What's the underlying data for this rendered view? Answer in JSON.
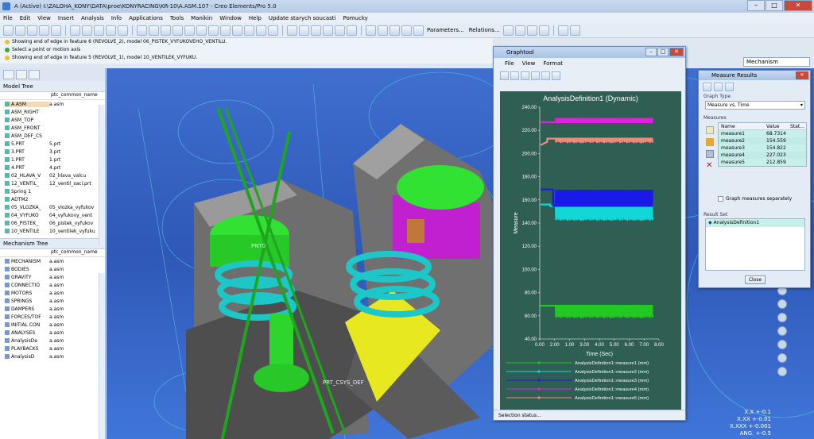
{
  "window": {
    "title": "A (Active) I:\\ZALOHA_KONY\\DATA\\proe\\KONYRACING\\KR-10\\A.ASM.107 - Creo Elements/Pro 5.0"
  },
  "menu": [
    "File",
    "Edit",
    "View",
    "Insert",
    "Analysis",
    "Info",
    "Applications",
    "Tools",
    "Manikin",
    "Window",
    "Help",
    "Update starych soucasti",
    "Pomucky"
  ],
  "toolbar": {
    "parameters": "Parameters...",
    "relations": "Relations..."
  },
  "messages": [
    "Showing end of edge in feature 6 (REVOLVE_2), model 06_PISTEK_VYFUKOVEHO_VENTILU.",
    "Select a point or motion axis",
    "Showing end of edge in feature 5 (REVOLVE_1), model 10_VENTILEK_VYFUKU."
  ],
  "model_tree": {
    "title": "Model Tree",
    "col": "ptc_common_name",
    "rows": [
      {
        "name": "A.ASM",
        "val": "a.asm",
        "sel": true
      },
      {
        "name": "ASM_RIGHT",
        "val": ""
      },
      {
        "name": "ASM_TOP",
        "val": ""
      },
      {
        "name": "ASM_FRONT",
        "val": ""
      },
      {
        "name": "ASM_DEF_CS",
        "val": ""
      },
      {
        "name": "5.PRT",
        "val": "5.prt"
      },
      {
        "name": "3.PRT",
        "val": "3.prt"
      },
      {
        "name": "1.PRT",
        "val": "1.prt"
      },
      {
        "name": "4.PRT",
        "val": "4.prt"
      },
      {
        "name": "02_HLAVA_V",
        "val": "02_hlava_valcu"
      },
      {
        "name": "12_VENTIL_",
        "val": "12_ventil_saci.prt"
      },
      {
        "name": "Spring 1",
        "val": ""
      },
      {
        "name": "ADTM2",
        "val": ""
      },
      {
        "name": "05_VLOZKA_",
        "val": "05_vlozka_vyfukov"
      },
      {
        "name": "04_VYFUKO",
        "val": "04_vyfukovy_vent"
      },
      {
        "name": "06_PISTEK_",
        "val": "06_pistek_vyfukov"
      },
      {
        "name": "10_VENTILE",
        "val": "10_ventilek_vyfuku"
      }
    ]
  },
  "mech_tree": {
    "title": "Mechanism Tree",
    "col": "ptc_common_name",
    "rows": [
      {
        "name": "MECHANISM",
        "val": "a.asm"
      },
      {
        "name": "BODIES",
        "val": "a.asm"
      },
      {
        "name": "GRAVITY",
        "val": "a.asm"
      },
      {
        "name": "CONNECTIO",
        "val": "a.asm"
      },
      {
        "name": "MOTORS",
        "val": "a.asm"
      },
      {
        "name": "SPRINGS",
        "val": "a.asm"
      },
      {
        "name": "DAMPERS",
        "val": "a.asm"
      },
      {
        "name": "FORCES/TOF",
        "val": "a.asm"
      },
      {
        "name": "INITIAL CON",
        "val": "a.asm"
      },
      {
        "name": "ANALYSES",
        "val": "a.asm"
      },
      {
        "name": "AnalysisDe",
        "val": "a.asm"
      },
      {
        "name": "PLAYBACKS",
        "val": "a.asm"
      },
      {
        "name": "AnalysisD",
        "val": "a.asm"
      }
    ]
  },
  "viewport": {
    "labels": [
      "PNT0",
      "PRT_CSYS_DEF"
    ]
  },
  "mechanism_dropdown": "Mechanism",
  "tolerances": [
    "X.X +-0.1",
    "X.XX +-0.01",
    "X.XXX +-0.001",
    "ANG. +-0.5"
  ],
  "graphtool": {
    "title": "Graphtool",
    "menu": [
      "File",
      "View",
      "Format"
    ],
    "status": "Selection status..."
  },
  "chart_data": {
    "type": "line",
    "title": "AnalysisDefinition1 (Dynamic)",
    "xlabel": "Time (Sec)",
    "ylabel": "Measure",
    "xlim": [
      0,
      8
    ],
    "ylim": [
      40,
      240
    ],
    "xticks": [
      "0.00",
      "2.00",
      "1.00",
      "3.00",
      "4.00",
      "5.00",
      "6.00",
      "7.00",
      "8.00"
    ],
    "yticks": [
      "40.00",
      "60.00",
      "80.00",
      "100.00",
      "120.00",
      "140.00",
      "160.00",
      "180.00",
      "200.00",
      "220.00",
      "240.00"
    ],
    "series": [
      {
        "name": "AnalysisDefinition1::measure1 (mm)",
        "color": "#22c922",
        "base": 68.7,
        "dip": 58
      },
      {
        "name": "AnalysisDefinition1::measure2 (mm)",
        "color": "#13d6d6",
        "base": 154.6,
        "dip": 142
      },
      {
        "name": "AnalysisDefinition1::measure3 (mm)",
        "color": "#1a1ae8",
        "base": 154.8,
        "peak": 168
      },
      {
        "name": "AnalysisDefinition1::measure4 (mm)",
        "color": "#e020e0",
        "base": 227.0,
        "peak": 230
      },
      {
        "name": "AnalysisDefinition1::measure5 (mm)",
        "color": "#f08a7a",
        "base": 212.9,
        "dip": 209
      }
    ]
  },
  "measure_results": {
    "title": "Measure Results",
    "graph_type_label": "Graph Type",
    "graph_type": "Measure vs. Time",
    "measures_label": "Measures",
    "cols": [
      "Name",
      "Value",
      "Stat..."
    ],
    "rows": [
      {
        "name": "measure1",
        "value": "68.7314"
      },
      {
        "name": "measure2",
        "value": "154.559"
      },
      {
        "name": "measure3",
        "value": "154.822"
      },
      {
        "name": "measure4",
        "value": "227.023"
      },
      {
        "name": "measure5",
        "value": "212.859"
      }
    ],
    "separately": "Graph measures separately",
    "result_set_label": "Result Set",
    "result_set": "AnalysisDefinition1",
    "close": "Close"
  }
}
